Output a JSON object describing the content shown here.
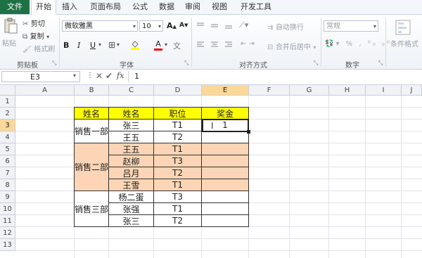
{
  "menu": {
    "file": "文件",
    "tabs": [
      "开始",
      "插入",
      "页面布局",
      "公式",
      "数据",
      "审阅",
      "视图",
      "开发工具"
    ],
    "active_index": 0
  },
  "ribbon": {
    "clipboard": {
      "paste": "粘贴",
      "cut": "剪切",
      "copy": "复制",
      "format_painter": "格式刷",
      "label": "剪贴板"
    },
    "font": {
      "name": "微软雅黑",
      "size": "10",
      "bold": "B",
      "italic": "I",
      "underline": "U",
      "font_color_letter": "A",
      "grow": "A",
      "shrink": "A",
      "label": "字体"
    },
    "alignment": {
      "wrap": "自动换行",
      "merge": "合并后居中",
      "label": "对齐方式"
    },
    "number": {
      "format": "常规",
      "label": "数字"
    },
    "styles": {
      "conditional": "条件格式"
    }
  },
  "formula_bar": {
    "name_box": "E3",
    "fx": "fx",
    "content": "1"
  },
  "columns": [
    "A",
    "B",
    "C",
    "D",
    "E",
    "F",
    "G",
    "H",
    "I",
    "J"
  ],
  "selected_column": "E",
  "selected_row": "3",
  "rows": [
    "1",
    "2",
    "3",
    "4",
    "5",
    "6",
    "7",
    "8",
    "9",
    "10",
    "11",
    "12",
    "13"
  ],
  "table": {
    "headers": [
      "姓名",
      "姓名",
      "职位",
      "奖金"
    ],
    "groups": [
      {
        "dept": "销售一部",
        "rows": [
          {
            "name": "张三",
            "pos": "T1",
            "bonus": "1"
          },
          {
            "name": "王五",
            "pos": "T2",
            "bonus": ""
          }
        ]
      },
      {
        "dept": "销售二部",
        "rows": [
          {
            "name": "王五",
            "pos": "T1",
            "bonus": ""
          },
          {
            "name": "赵柳",
            "pos": "T3",
            "bonus": ""
          },
          {
            "name": "吕月",
            "pos": "T2",
            "bonus": ""
          },
          {
            "name": "王雪",
            "pos": "T1",
            "bonus": ""
          }
        ]
      },
      {
        "dept": "销售三部",
        "rows": [
          {
            "name": "杨二蛋",
            "pos": "T3",
            "bonus": ""
          },
          {
            "name": "张强",
            "pos": "T1",
            "bonus": ""
          },
          {
            "name": "张三",
            "pos": "T2",
            "bonus": ""
          }
        ]
      }
    ]
  },
  "colors": {
    "header_yellow": "#ffff00",
    "group2_fill": "#fbd5b5",
    "excel_green": "#1e7145"
  }
}
